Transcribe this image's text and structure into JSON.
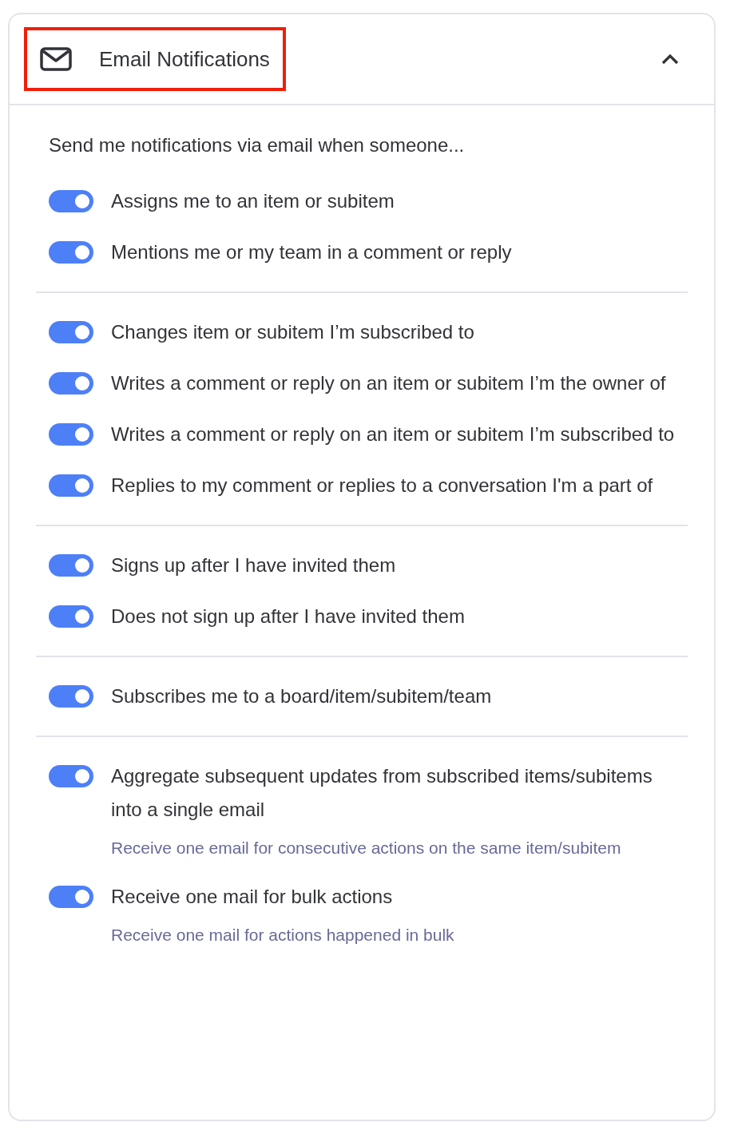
{
  "header": {
    "title": "Email Notifications",
    "expanded": true,
    "highlighted": true
  },
  "intro": "Send me notifications via email when someone...",
  "groups": [
    {
      "items": [
        {
          "label": "Assigns me to an item or subitem",
          "on": true
        },
        {
          "label": "Mentions me or my team in a comment or reply",
          "on": true
        }
      ]
    },
    {
      "items": [
        {
          "label": "Changes item or subitem I’m subscribed to",
          "on": true
        },
        {
          "label": "Writes a comment or reply on an item or subitem I’m the owner of",
          "on": true
        },
        {
          "label": "Writes a comment or reply on an item or subitem I’m subscribed to",
          "on": true
        },
        {
          "label": "Replies to my comment or replies to a conversation I'm a part of",
          "on": true
        }
      ]
    },
    {
      "items": [
        {
          "label": "Signs up after I have invited them",
          "on": true
        },
        {
          "label": "Does not sign up after I have invited them",
          "on": true
        }
      ]
    },
    {
      "items": [
        {
          "label": "Subscribes me to a board/item/subitem/team",
          "on": true
        }
      ]
    },
    {
      "items": [
        {
          "label": "Aggregate subsequent updates from subscribed items/subitems into a single email",
          "on": true,
          "description": "Receive one email for consecutive actions on the same item/subitem"
        },
        {
          "label": "Receive one mail for bulk actions",
          "on": true,
          "description": "Receive one mail for actions happened in bulk"
        }
      ]
    }
  ]
}
